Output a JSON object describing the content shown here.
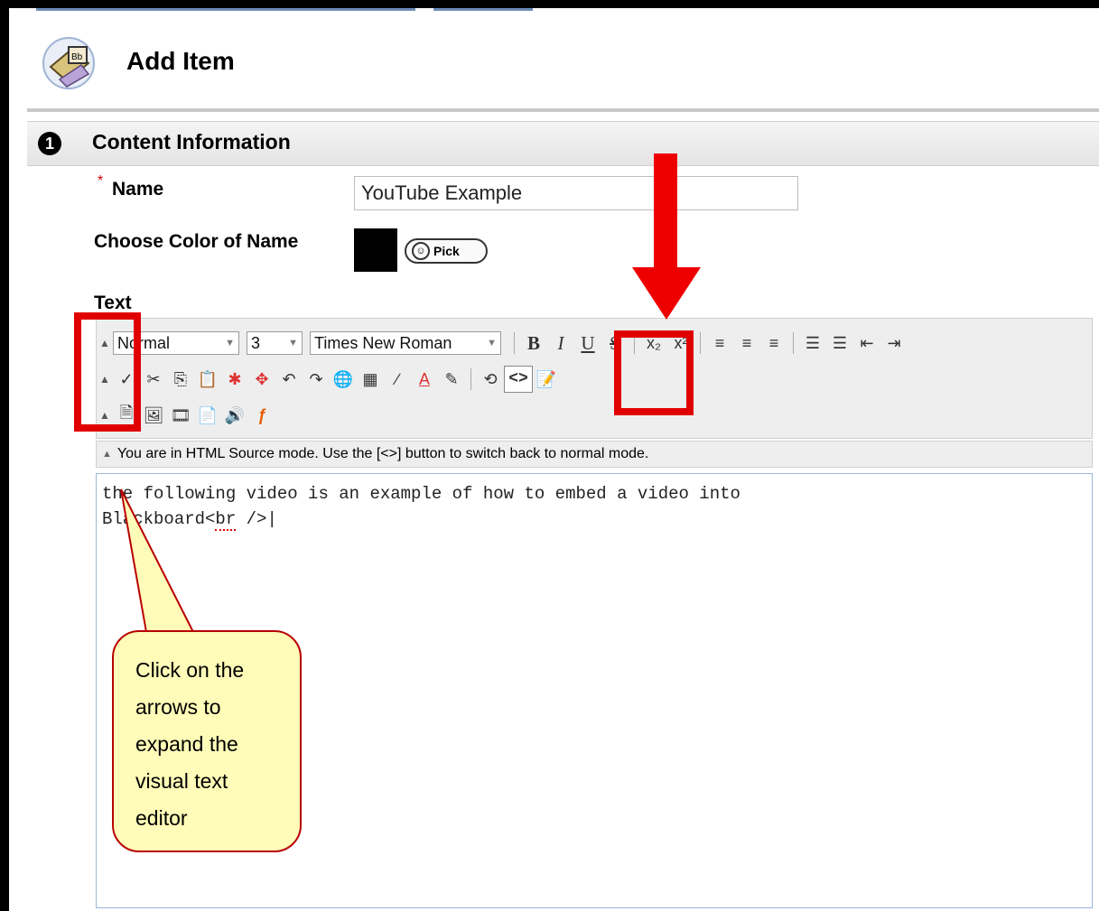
{
  "page": {
    "title": "Add Item",
    "section_number": "1",
    "section_title": "Content Information"
  },
  "form": {
    "required_marker": "*",
    "name_label": "Name",
    "name_value": "YouTube Example",
    "color_label": "Choose Color of Name",
    "color_value": "#000000",
    "pick_label": "Pick",
    "text_label": "Text"
  },
  "toolbar": {
    "format_select": "Normal",
    "size_select": "3",
    "font_select": "Times New Roman",
    "bold": "B",
    "italic": "I",
    "underline": "U",
    "strikethrough": "S",
    "html_source": "<>"
  },
  "status": {
    "message": "You are in HTML Source mode. Use the [<>] button to switch back to normal mode."
  },
  "editor": {
    "line1": "the following video is an example of how to embed a video into",
    "line2_prefix": "Blackboard<",
    "line2_tag": "br",
    "line2_suffix": " />"
  },
  "annotation": {
    "callout_text": "Click on the arrows to expand the visual text editor",
    "highlight_color": "#e00000"
  }
}
